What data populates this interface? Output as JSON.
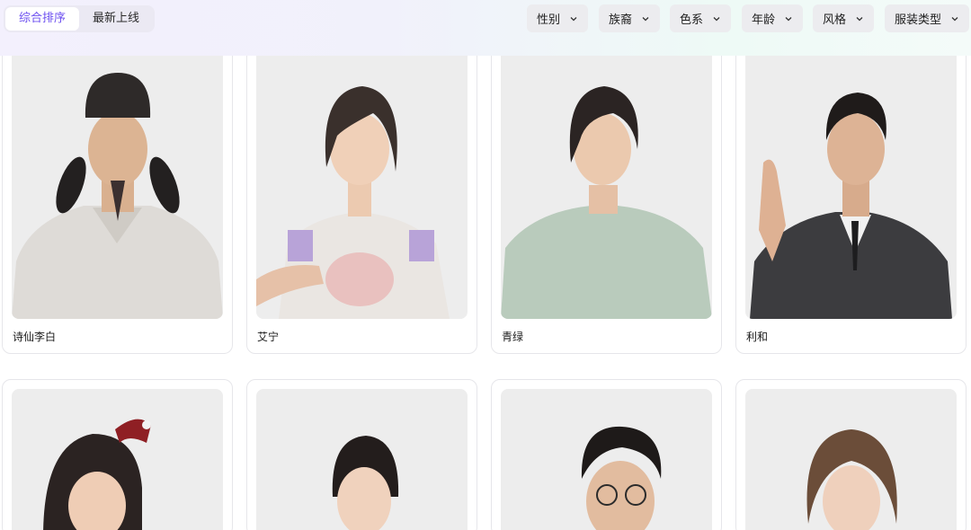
{
  "sort_tabs": [
    {
      "label": "综合排序",
      "active": true
    },
    {
      "label": "最新上线",
      "active": false
    }
  ],
  "filters": [
    {
      "label": "性别",
      "icon": "chevron-down-icon"
    },
    {
      "label": "族裔",
      "icon": "chevron-down-icon"
    },
    {
      "label": "色系",
      "icon": "chevron-down-icon"
    },
    {
      "label": "年龄",
      "icon": "chevron-down-icon"
    },
    {
      "label": "风格",
      "icon": "chevron-down-icon"
    },
    {
      "label": "服装类型",
      "icon": "chevron-down-icon"
    }
  ],
  "avatars": [
    {
      "name": "诗仙李白"
    },
    {
      "name": "艾宁"
    },
    {
      "name": "青绿"
    },
    {
      "name": "利和"
    },
    {
      "name": ""
    },
    {
      "name": ""
    },
    {
      "name": ""
    },
    {
      "name": ""
    }
  ],
  "colors": {
    "accent": "#6c4ff0",
    "card_border": "#e6e6ea",
    "photo_bg": "#ededed"
  }
}
